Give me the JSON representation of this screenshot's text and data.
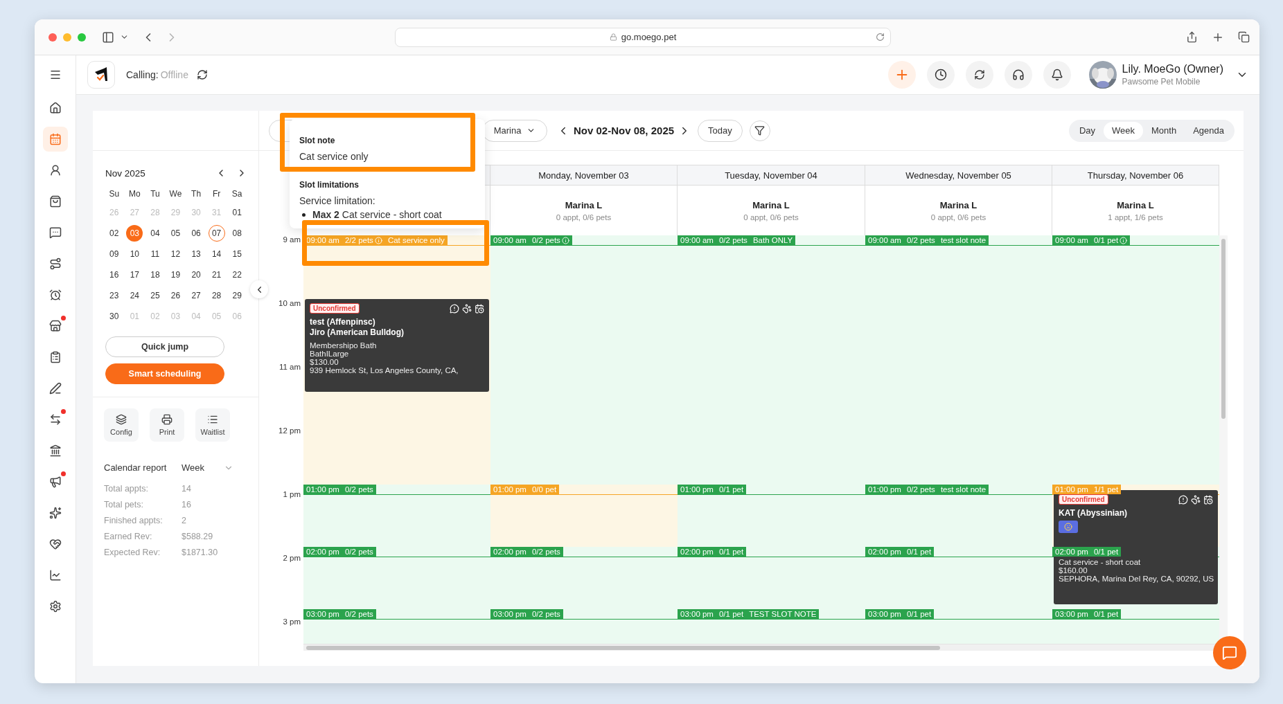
{
  "browser": {
    "url": "go.moego.pet"
  },
  "rail": [
    {
      "selected": false,
      "badge": false
    },
    {
      "selected": true,
      "badge": false
    },
    {
      "selected": false,
      "badge": false
    },
    {
      "selected": false,
      "badge": false
    },
    {
      "selected": false,
      "badge": false
    },
    {
      "selected": false,
      "badge": false
    },
    {
      "selected": false,
      "badge": false
    },
    {
      "selected": false,
      "badge": true
    },
    {
      "selected": false,
      "badge": false
    },
    {
      "selected": false,
      "badge": false
    },
    {
      "selected": false,
      "badge": true
    },
    {
      "selected": false,
      "badge": false
    },
    {
      "selected": false,
      "badge": true
    },
    {
      "selected": false,
      "badge": false
    },
    {
      "selected": false,
      "badge": false
    },
    {
      "selected": false,
      "badge": false
    },
    {
      "selected": false,
      "badge": false
    }
  ],
  "header": {
    "calling_label": "Calling:",
    "calling_status": "Offline",
    "user_name": "Lily. MoeGo (Owner)",
    "business": "Pawsome Pet Mobile"
  },
  "mini_calendar": {
    "month": "Nov 2025",
    "weekdays": [
      "Su",
      "Mo",
      "Tu",
      "We",
      "Th",
      "Fr",
      "Sa"
    ],
    "weeks": [
      [
        {
          "label": "26",
          "muted": true,
          "selected": false,
          "today": false
        },
        {
          "label": "27",
          "muted": true,
          "selected": false,
          "today": false
        },
        {
          "label": "28",
          "muted": true,
          "selected": false,
          "today": false
        },
        {
          "label": "29",
          "muted": true,
          "selected": false,
          "today": false
        },
        {
          "label": "30",
          "muted": true,
          "selected": false,
          "today": false
        },
        {
          "label": "31",
          "muted": true,
          "selected": false,
          "today": false
        },
        {
          "label": "01",
          "muted": false,
          "selected": false,
          "today": false
        }
      ],
      [
        {
          "label": "02",
          "muted": false,
          "selected": false,
          "today": false
        },
        {
          "label": "03",
          "muted": false,
          "selected": true,
          "today": false
        },
        {
          "label": "04",
          "muted": false,
          "selected": false,
          "today": false
        },
        {
          "label": "05",
          "muted": false,
          "selected": false,
          "today": false
        },
        {
          "label": "06",
          "muted": false,
          "selected": false,
          "today": false
        },
        {
          "label": "07",
          "muted": false,
          "selected": false,
          "today": true
        },
        {
          "label": "08",
          "muted": false,
          "selected": false,
          "today": false
        }
      ],
      [
        {
          "label": "09",
          "muted": false,
          "selected": false,
          "today": false
        },
        {
          "label": "10",
          "muted": false,
          "selected": false,
          "today": false
        },
        {
          "label": "11",
          "muted": false,
          "selected": false,
          "today": false
        },
        {
          "label": "12",
          "muted": false,
          "selected": false,
          "today": false
        },
        {
          "label": "13",
          "muted": false,
          "selected": false,
          "today": false
        },
        {
          "label": "14",
          "muted": false,
          "selected": false,
          "today": false
        },
        {
          "label": "15",
          "muted": false,
          "selected": false,
          "today": false
        }
      ],
      [
        {
          "label": "16",
          "muted": false,
          "selected": false,
          "today": false
        },
        {
          "label": "17",
          "muted": false,
          "selected": false,
          "today": false
        },
        {
          "label": "18",
          "muted": false,
          "selected": false,
          "today": false
        },
        {
          "label": "19",
          "muted": false,
          "selected": false,
          "today": false
        },
        {
          "label": "20",
          "muted": false,
          "selected": false,
          "today": false
        },
        {
          "label": "21",
          "muted": false,
          "selected": false,
          "today": false
        },
        {
          "label": "22",
          "muted": false,
          "selected": false,
          "today": false
        }
      ],
      [
        {
          "label": "23",
          "muted": false,
          "selected": false,
          "today": false
        },
        {
          "label": "24",
          "muted": false,
          "selected": false,
          "today": false
        },
        {
          "label": "25",
          "muted": false,
          "selected": false,
          "today": false
        },
        {
          "label": "26",
          "muted": false,
          "selected": false,
          "today": false
        },
        {
          "label": "27",
          "muted": false,
          "selected": false,
          "today": false
        },
        {
          "label": "28",
          "muted": false,
          "selected": false,
          "today": false
        },
        {
          "label": "29",
          "muted": false,
          "selected": false,
          "today": false
        }
      ],
      [
        {
          "label": "30",
          "muted": false,
          "selected": false,
          "today": false
        },
        {
          "label": "01",
          "muted": true,
          "selected": false,
          "today": false
        },
        {
          "label": "02",
          "muted": true,
          "selected": false,
          "today": false
        },
        {
          "label": "03",
          "muted": true,
          "selected": false,
          "today": false
        },
        {
          "label": "04",
          "muted": true,
          "selected": false,
          "today": false
        },
        {
          "label": "05",
          "muted": true,
          "selected": false,
          "today": false
        },
        {
          "label": "06",
          "muted": true,
          "selected": false,
          "today": false
        }
      ]
    ]
  },
  "actions": [
    {
      "label": "Quick jump",
      "kind": "outline"
    },
    {
      "label": "Smart scheduling",
      "kind": "primary"
    }
  ],
  "tools": [
    {
      "label": "Config"
    },
    {
      "label": "Print"
    },
    {
      "label": "Waitlist"
    }
  ],
  "report": {
    "title": "Calendar report",
    "period": "Week",
    "stats": [
      {
        "label": "Total appts:",
        "value": "14"
      },
      {
        "label": "Total pets:",
        "value": "16"
      },
      {
        "label": "Finished appts:",
        "value": "2"
      },
      {
        "label": "Earned Rev:",
        "value": "$588.29"
      },
      {
        "label": "Expected Rev:",
        "value": "$1871.30"
      }
    ]
  },
  "toolbar": {
    "staff": "Marina",
    "range": "Nov 02-Nov 08, 2025",
    "today": "Today",
    "views": [
      {
        "label": "Day",
        "selected": false
      },
      {
        "label": "Week",
        "selected": true
      },
      {
        "label": "Month",
        "selected": false
      },
      {
        "label": "Agenda",
        "selected": false
      }
    ]
  },
  "times": [
    "9 am",
    "10 am",
    "11 am",
    "12 pm",
    "1 pm",
    "2 pm",
    "3 pm"
  ],
  "columns": [
    {
      "slots": [
        {
          "time": "09:00 am",
          "pets": "2/2 pets",
          "info": true,
          "note": "Cat service only",
          "full": true
        },
        {
          "time": "01:00 pm",
          "pets": "0/2 pets",
          "info": false,
          "full": false
        },
        {
          "time": "02:00 pm",
          "pets": "0/2 pets",
          "info": false,
          "full": false
        },
        {
          "time": "03:00 pm",
          "pets": "0/2 pets",
          "info": false,
          "full": false
        }
      ],
      "appointments": [
        {
          "status": "Unconfirmed",
          "pets": [
            "test (Affenpinsc)",
            "Jiro (American Bulldog)"
          ],
          "tag": false,
          "details": [
            "Membershipo Bath",
            "BathILarge",
            "$130.00",
            "939 Hemlock St, Los Angeles County, CA,"
          ]
        }
      ]
    },
    {
      "day": "Monday, November 03",
      "staff": "Marina L",
      "summary": "0 appt, 0/6 pets",
      "slots": [
        {
          "time": "09:00 am",
          "pets": "0/2 pets",
          "info": true,
          "full": false
        },
        {
          "time": "01:00 pm",
          "pets": "0/0 pet",
          "info": false,
          "full": true
        },
        {
          "time": "02:00 pm",
          "pets": "0/2 pets",
          "info": false,
          "full": false
        },
        {
          "time": "03:00 pm",
          "pets": "0/2 pets",
          "info": false,
          "full": false
        }
      ]
    },
    {
      "day": "Tuesday, November 04",
      "staff": "Marina L",
      "summary": "0 appt, 0/6 pets",
      "slots": [
        {
          "time": "09:00 am",
          "pets": "0/2 pets",
          "info": false,
          "note": "Bath ONLY",
          "full": false
        },
        {
          "time": "01:00 pm",
          "pets": "0/1 pet",
          "info": false,
          "full": false
        },
        {
          "time": "02:00 pm",
          "pets": "0/1 pet",
          "info": false,
          "full": false
        },
        {
          "time": "03:00 pm",
          "pets": "0/1 pet",
          "info": false,
          "note": "TEST SLOT NOTE",
          "full": false
        }
      ]
    },
    {
      "day": "Wednesday, November 05",
      "staff": "Marina L",
      "summary": "0 appt, 0/6 pets",
      "slots": [
        {
          "time": "09:00 am",
          "pets": "0/2 pets",
          "info": false,
          "note": "test slot note",
          "full": false
        },
        {
          "time": "01:00 pm",
          "pets": "0/2 pets",
          "info": false,
          "note": "test slot note",
          "full": false
        },
        {
          "time": "02:00 pm",
          "pets": "0/1 pet",
          "info": false,
          "full": false
        },
        {
          "time": "03:00 pm",
          "pets": "0/1 pet",
          "info": false,
          "full": false
        }
      ]
    },
    {
      "day": "Thursday, November 06",
      "staff": "Marina L",
      "summary": "1 appt, 1/6 pets",
      "slots": [
        {
          "time": "09:00 am",
          "pets": "0/1 pet",
          "info": true,
          "full": false
        },
        {
          "time": "01:00 pm",
          "pets": "1/1 pet",
          "info": false,
          "full": true
        },
        {
          "time": "02:00 pm",
          "pets": "0/1 pet",
          "info": false,
          "full": false
        },
        {
          "time": "03:00 pm",
          "pets": "0/1 pet",
          "info": false,
          "full": false
        }
      ],
      "appointments": [
        {
          "status": "Unconfirmed",
          "pets": [
            "KAT (Abyssinian)"
          ],
          "tag": true,
          "details": [
            "Cat service - short coat",
            "$160.00",
            "SEPHORA, Marina Del Rey, CA, 90292, US"
          ]
        }
      ]
    }
  ],
  "popover": {
    "title": "Slot note",
    "note": "Cat service only",
    "section": "Slot limitations",
    "limitation_label": "Service limitation:",
    "items": [
      "**Max 2** Cat service - short coat"
    ]
  }
}
